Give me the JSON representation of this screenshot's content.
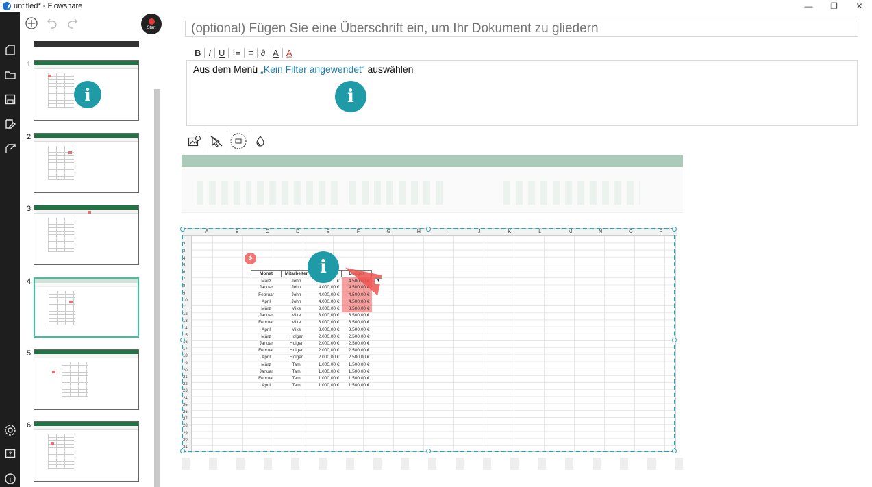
{
  "window": {
    "title": "untitled* - Flowshare",
    "controls": [
      "minimize",
      "maximize",
      "close"
    ]
  },
  "rail": {
    "icons": [
      "new-document-icon",
      "open-folder-icon",
      "save-icon",
      "edit-export-icon",
      "share-icon",
      "settings-icon",
      "help-icon",
      "info-icon"
    ]
  },
  "thumb_toolbar": {
    "start_label": "Start"
  },
  "steps": [
    {
      "number": "1",
      "selected": false,
      "has_info": true
    },
    {
      "number": "2",
      "selected": false,
      "has_info": false
    },
    {
      "number": "3",
      "selected": false,
      "has_info": false
    },
    {
      "number": "4",
      "selected": true,
      "has_info": false
    },
    {
      "number": "5",
      "selected": false,
      "has_info": false
    },
    {
      "number": "6",
      "selected": false,
      "has_info": false
    }
  ],
  "editor": {
    "heading_placeholder": "(optional) Fügen Sie eine Überschrift ein, um Ihr Dokument zu gliedern",
    "format_buttons": [
      "B",
      "I",
      "U",
      "⁝≡",
      "≡",
      "∂",
      "A",
      "A̲"
    ],
    "step_text_prefix": "Aus dem Menü ",
    "step_text_menu": "„Kein Filter angewendet“",
    "step_text_suffix": " auswählen",
    "info_glyph": "i"
  },
  "screenshot": {
    "columns": [
      "A",
      "B",
      "C",
      "D",
      "E",
      "F",
      "G",
      "H",
      "I",
      "J",
      "K",
      "L",
      "M",
      "N",
      "O",
      "P"
    ],
    "rows": [
      "1",
      "2",
      "3",
      "4",
      "5",
      "6",
      "7",
      "8",
      "9",
      "10",
      "11",
      "12",
      "13",
      "14",
      "15",
      "16",
      "17",
      "18",
      "19",
      "20",
      "21",
      "22",
      "23",
      "24",
      "25",
      "26",
      "27",
      "28",
      "29",
      "30",
      "31"
    ],
    "table_headers": [
      "Monat",
      "Mitarbeiter",
      "",
      "Budget"
    ],
    "table_rows": [
      [
        "März",
        "John",
        "€",
        "4.500,00 €"
      ],
      [
        "Januar",
        "John",
        "4.000,00 €",
        "4.500,00 €"
      ],
      [
        "Februar",
        "John",
        "4.000,00 €",
        "4.500,00 €"
      ],
      [
        "April",
        "John",
        "4.000,00 €",
        "4.500,00 €"
      ],
      [
        "März",
        "Mike",
        "3.000,00 €",
        "3.500,00 €"
      ],
      [
        "Januar",
        "Mike",
        "3.000,00 €",
        "3.500,00 €"
      ],
      [
        "Februar",
        "Mike",
        "3.000,00 €",
        "3.500,00 €"
      ],
      [
        "April",
        "Mike",
        "3.000,00 €",
        "3.500,00 €"
      ],
      [
        "März",
        "Holger",
        "2.000,00 €",
        "2.500,00 €"
      ],
      [
        "Januar",
        "Holger",
        "2.000,00 €",
        "2.500,00 €"
      ],
      [
        "Februar",
        "Holger",
        "2.000,00 €",
        "2.500,00 €"
      ],
      [
        "April",
        "Holger",
        "2.000,00 €",
        "2.500,00 €"
      ],
      [
        "März",
        "Tam",
        "1.000,00 €",
        "1.500,00 €"
      ],
      [
        "Januar",
        "Tam",
        "1.000,00 €",
        "1.500,00 €"
      ],
      [
        "Februar",
        "Tam",
        "1.000,00 €",
        "1.500,00 €"
      ],
      [
        "April",
        "Tam",
        "1.000,00 €",
        "1.500,00 €"
      ]
    ]
  },
  "colors": {
    "accent": "#1e9ba6",
    "selected_border": "#35c79a",
    "excel_green": "#217346",
    "highlight_red": "#ef5350"
  }
}
